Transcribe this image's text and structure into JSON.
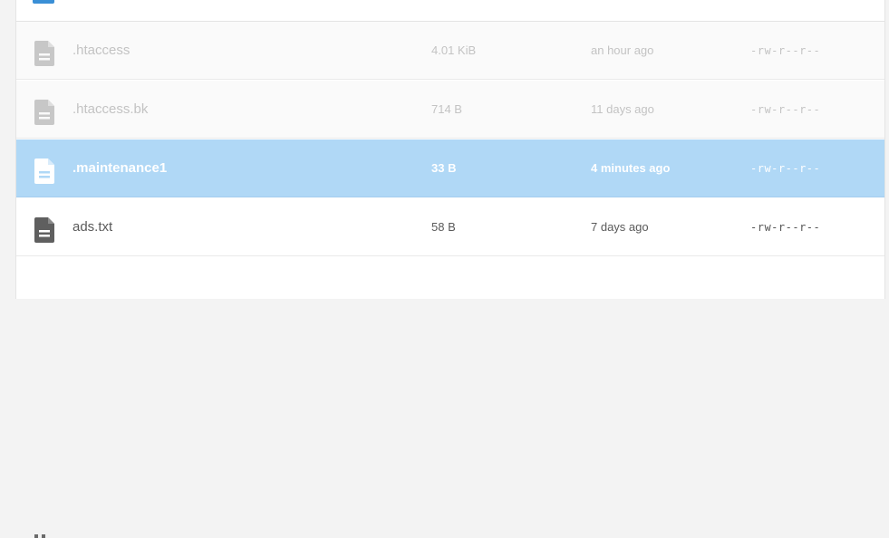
{
  "files": [
    {
      "name": ".htaccess",
      "size": "4.01 KiB",
      "modified": "an hour ago",
      "permissions": "-rw-r--r--",
      "state": "faded",
      "icon": "file-icon"
    },
    {
      "name": ".htaccess.bk",
      "size": "714 B",
      "modified": "11 days ago",
      "permissions": "-rw-r--r--",
      "state": "faded",
      "icon": "file-icon"
    },
    {
      "name": ".maintenance1",
      "size": "33 B",
      "modified": "4 minutes ago",
      "permissions": "-rw-r--r--",
      "state": "selected",
      "icon": "file-icon"
    },
    {
      "name": "ads.txt",
      "size": "58 B",
      "modified": "7 days ago",
      "permissions": "-rw-r--r--",
      "state": "normal",
      "icon": "file-icon"
    }
  ],
  "colors": {
    "selected_row": "#b0d8f6",
    "faded_text": "#c3c3c3",
    "normal_text": "#5a5a5a",
    "accent": "#3a8fd6"
  }
}
